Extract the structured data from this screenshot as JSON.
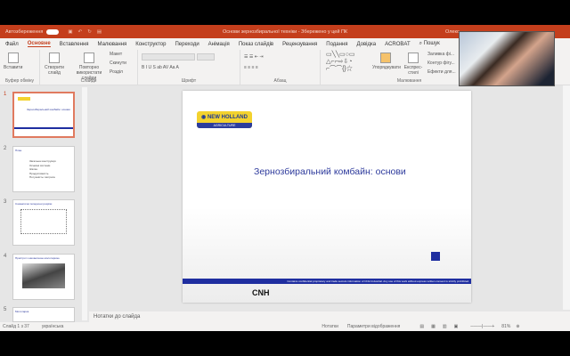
{
  "titlebar": {
    "autosave": "Автозбереження",
    "doc_title": "Основи зернозбиральної техніки  -  Збережено у цей ПК",
    "user": "Олекс..."
  },
  "tabs": [
    "Файл",
    "Основне",
    "Вставлення",
    "Малювання",
    "Конструктор",
    "Переходи",
    "Анімація",
    "Показ слайдів",
    "Рецензування",
    "Подання",
    "Довідка",
    "ACROBAT"
  ],
  "search": "Пошук",
  "ribbon": {
    "paste": "Вставити",
    "clipboard": "Буфер обміну",
    "new_slide": "Створити слайд",
    "reuse": "Повторно використати слайди",
    "layout": "Макет",
    "reset": "Скинути",
    "section": "Розділ",
    "slides": "Слайди",
    "font": "Шрифт",
    "paragraph": "Абзац",
    "arrange": "Упорядкувати",
    "quick_styles": "Експрес-стилі",
    "fill": "Заливка фі...",
    "outline": "Контур фігу...",
    "effects": "Ефекти для...",
    "drawing": "Малювання"
  },
  "thumbnails": [
    {
      "num": "1",
      "title": "Зернозбиральний комбайн: основи"
    },
    {
      "num": "2",
      "title": "План",
      "bullets": [
        "Загальна конструкція",
        "Основні системи",
        "Жатка",
        "Продуктивність",
        "Потужність і витрата"
      ]
    },
    {
      "num": "3",
      "title": "Схематичні поперечні розрізи"
    },
    {
      "num": "4",
      "title": "Пристрої з механічною молотаркою"
    },
    {
      "num": "5",
      "title": "Молотарка"
    }
  ],
  "slide": {
    "logo_top": "NEW HOLLAND",
    "logo_bottom": "AGRICULTURE",
    "title": "Зернозбиральний комбайн: основи",
    "footer": "Contains confidential proprietary and trade secrets information of CNH Industrial. Any use of this work without express written consent is strictly prohibited.",
    "cnh": "CNH"
  },
  "notes_placeholder": "Нотатки до слайда",
  "status": {
    "slide_count": "Слайд 1 з 37",
    "language": "українська",
    "notes": "Нотатки",
    "display": "Параметри відображення",
    "zoom": "81%"
  },
  "colors": {
    "accent": "#c43e1c",
    "slide_blue": "#1f2ea0"
  }
}
